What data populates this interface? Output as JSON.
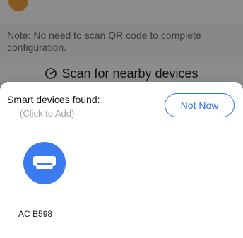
{
  "background": {
    "top_title": "",
    "note_text": "Note: No need to scan QR code to complete configuration.",
    "scan_label": "Scan for nearby devices"
  },
  "sheet": {
    "title": "Smart devices found:",
    "subtitle": "(Click to Add)",
    "not_now_label": "Not Now"
  },
  "devices": [
    {
      "name": "AC B598",
      "icon": "air-conditioner-icon"
    }
  ],
  "colors": {
    "accent": "#2d6ef6",
    "tile": "#3a7bf0",
    "dim_overlay": "rgba(0,0,0,0.45)"
  }
}
